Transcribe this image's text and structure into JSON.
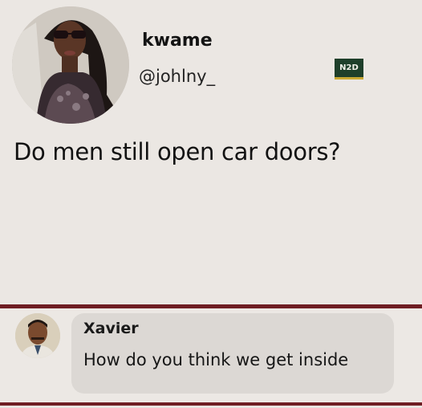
{
  "post": {
    "display_name": "kwame",
    "handle": "@johlny_",
    "text": "Do men still open car doors?",
    "watermark": "N2D"
  },
  "reply": {
    "name": "Xavier",
    "text": "How do you think we get inside"
  },
  "colors": {
    "background": "#ebe7e3",
    "divider": "#6f1e24",
    "bubble": "#dcd8d4",
    "watermark_bg": "#1e3f2a"
  },
  "icons": [
    "profile-avatar",
    "reply-avatar"
  ]
}
